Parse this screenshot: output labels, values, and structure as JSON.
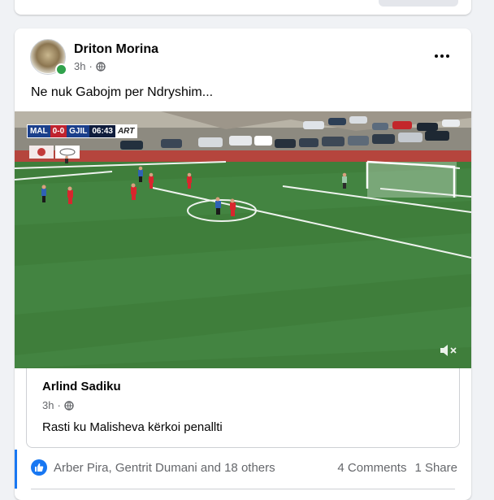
{
  "post": {
    "author": "Driton Morina",
    "time": "3h",
    "separator": "·",
    "privacy_icon": "globe-icon",
    "text": "Ne nuk Gabojm per Ndryshim...",
    "more_icon": "more-options-icon"
  },
  "video": {
    "scoreboard": {
      "home": "MAL",
      "score": "0-0",
      "away": "GJIL",
      "clock": "06:43",
      "channel": "ART"
    },
    "mute_icon": "speaker-muted-icon"
  },
  "shared": {
    "author": "Arlind Sadiku",
    "time": "3h",
    "separator": "·",
    "text": "Rasti ku Malisheva kërkoi penallti"
  },
  "footer": {
    "reactors": "Arber Pira, Gentrit Dumani and 18 others",
    "comments": "4 Comments",
    "shares": "1 Share",
    "like_icon": "like-icon"
  },
  "colors": {
    "accent": "#1877f2",
    "pitch": "#3d7a3a",
    "home_team": "#1b3f8b",
    "away_team": "#d8262d"
  }
}
